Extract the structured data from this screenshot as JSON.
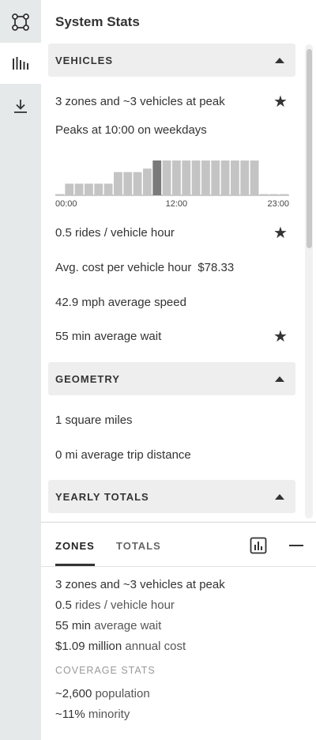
{
  "rail": {
    "items": [
      {
        "icon": "zones-square-icon",
        "active": false
      },
      {
        "icon": "stats-bars-icon",
        "active": true
      },
      {
        "icon": "download-icon",
        "active": false
      }
    ]
  },
  "panel": {
    "title": "System Stats",
    "sections": {
      "vehicles": {
        "label": "VEHICLES"
      },
      "geometry": {
        "label": "GEOMETRY"
      },
      "yearly": {
        "label": "YEARLY TOTALS"
      }
    },
    "vehicles": {
      "zones_line": "3 zones and ~3 vehicles at peak",
      "peak_line": "Peaks at 10:00 on weekdays",
      "rides_line": "0.5 rides / vehicle hour",
      "cost_label": "Avg. cost per vehicle hour",
      "cost_value": "$78.33",
      "speed_line": "42.9 mph average speed",
      "wait_line": "55 min average wait"
    },
    "geometry": {
      "area_line": "1 square miles",
      "trip_line": "0 mi average trip distance"
    }
  },
  "chart_data": {
    "type": "bar",
    "categories": [
      "00:00",
      "01:00",
      "02:00",
      "03:00",
      "04:00",
      "05:00",
      "06:00",
      "07:00",
      "08:00",
      "09:00",
      "10:00",
      "11:00",
      "12:00",
      "13:00",
      "14:00",
      "15:00",
      "16:00",
      "17:00",
      "18:00",
      "19:00",
      "20:00",
      "21:00",
      "22:00",
      "23:00"
    ],
    "values": [
      0.1,
      1,
      1,
      1,
      1,
      1,
      2,
      2,
      2,
      2.3,
      3,
      3,
      3,
      3,
      3,
      3,
      3,
      3,
      3,
      3,
      3,
      0.1,
      0.1,
      0.1
    ],
    "highlight_index": 10,
    "tick_labels": [
      "00:00",
      "12:00",
      "23:00"
    ],
    "ylim": [
      0,
      3
    ],
    "bar_color": "#c4c4c4",
    "highlight_color": "#7a7a7a",
    "xlabel": "",
    "ylabel": "",
    "title": ""
  },
  "bottom": {
    "tabs": [
      {
        "label": "ZONES",
        "active": true
      },
      {
        "label": "TOTALS",
        "active": false
      }
    ],
    "summary": {
      "line1": {
        "value": "3 zones and ~3 vehicles at peak"
      },
      "line2": {
        "value": "0.5",
        "unit": "rides / vehicle hour"
      },
      "line3": {
        "value": "55 min",
        "unit": "average wait"
      },
      "line4": {
        "value": "$1.09 million",
        "unit": "annual cost"
      },
      "coverage_label": "COVERAGE STATS",
      "line5": {
        "value": "~2,600",
        "unit": "population"
      },
      "line6": {
        "value": "~11%",
        "unit": "minority"
      }
    }
  }
}
